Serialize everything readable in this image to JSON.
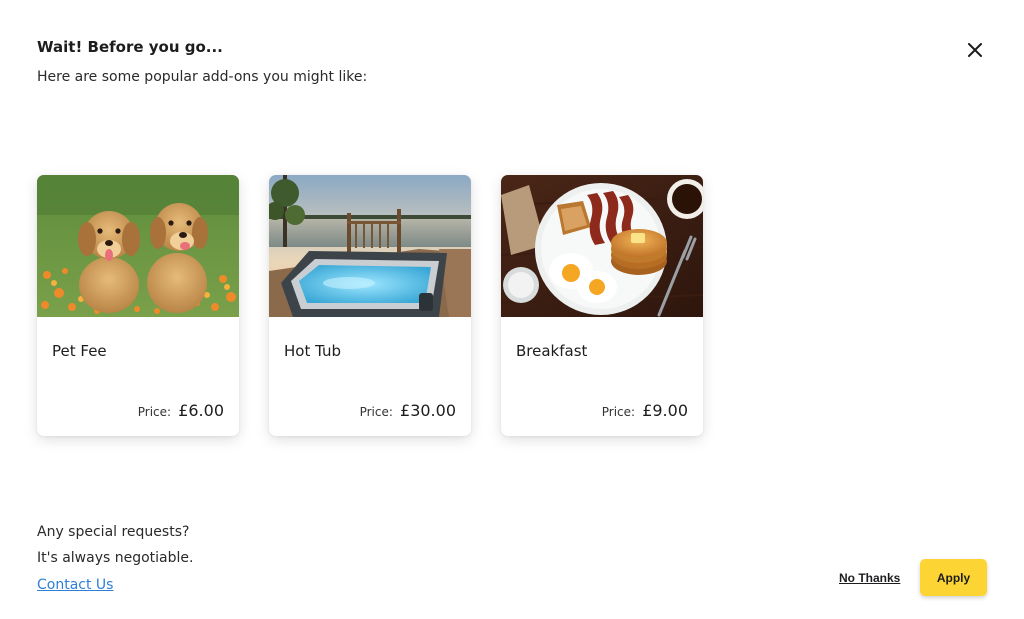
{
  "header": {
    "title": "Wait! Before you go...",
    "subtitle": "Here are some popular add-ons you might like:"
  },
  "icons": {
    "close": "close-icon"
  },
  "addons": [
    {
      "name": "Pet Fee",
      "price_label": "Price:",
      "price": "£6.00",
      "image": "puppies-photo"
    },
    {
      "name": "Hot Tub",
      "price_label": "Price:",
      "price": "£30.00",
      "image": "hot-tub-photo"
    },
    {
      "name": "Breakfast",
      "price_label": "Price:",
      "price": "£9.00",
      "image": "breakfast-photo"
    }
  ],
  "footer": {
    "line1": "Any special requests?",
    "line2": "It's always negotiable.",
    "contact_link": "Contact Us",
    "no_thanks_label": "No Thanks",
    "apply_label": "Apply"
  },
  "colors": {
    "accent_button": "#fcd535",
    "link": "#2f7fd6"
  }
}
